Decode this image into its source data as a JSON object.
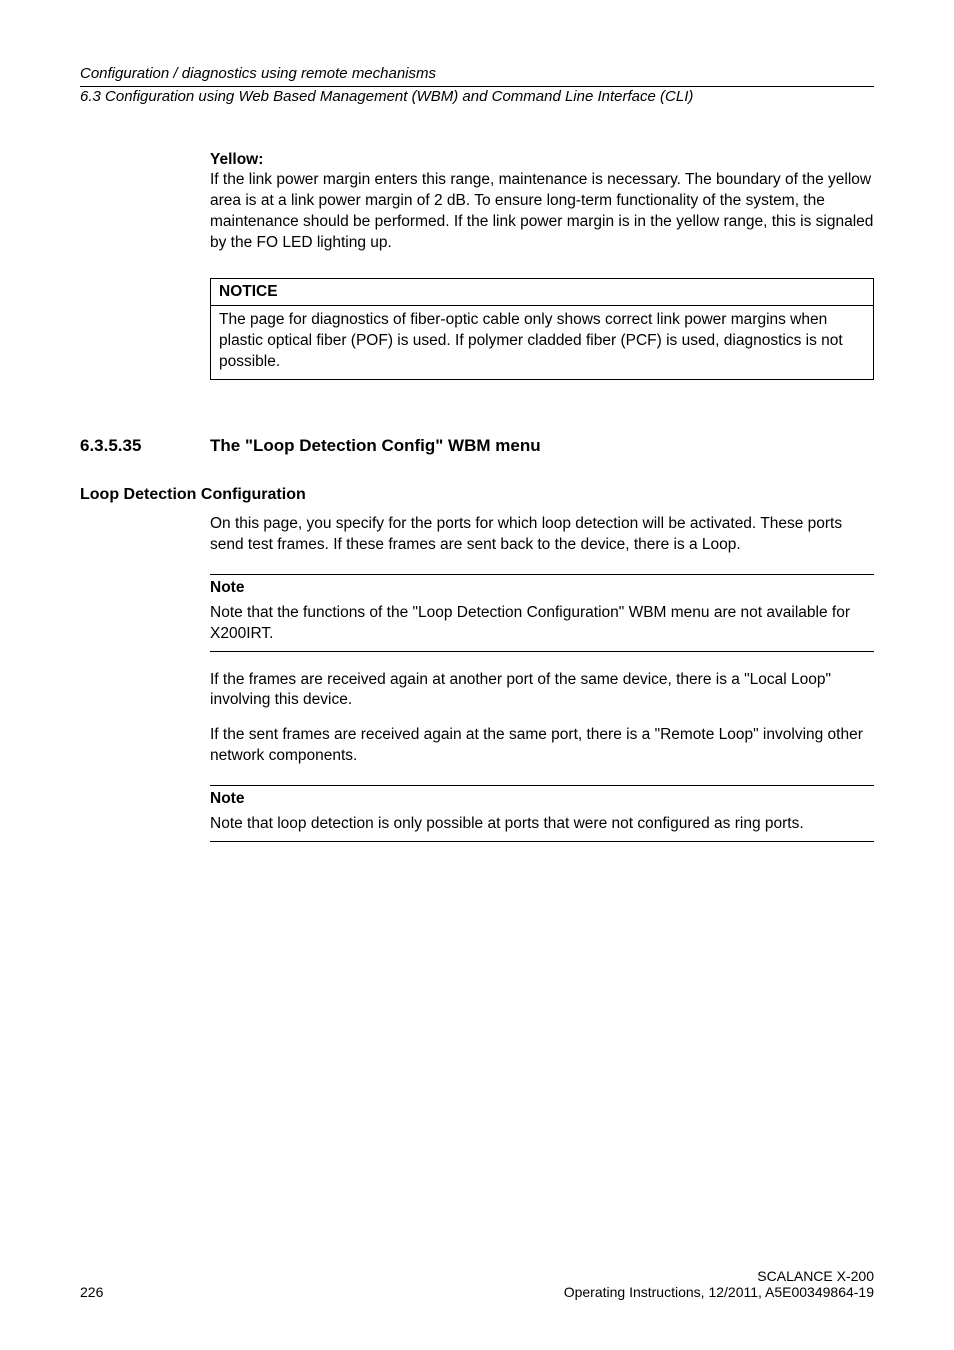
{
  "header": {
    "line1": "Configuration / diagnostics using remote mechanisms",
    "line2": "6.3 Configuration using Web Based Management (WBM) and Command Line Interface (CLI)"
  },
  "yellow": {
    "title": "Yellow:",
    "body": "If the link power margin enters this range, maintenance is necessary. The boundary of the yellow area is at a link power margin of 2 dB. To ensure long-term functionality of the system, the maintenance should be performed. If the link power margin is in the yellow range, this is signaled by the FO LED lighting up."
  },
  "notice": {
    "title": "NOTICE",
    "body": "The page for diagnostics of fiber-optic cable only shows correct link power margins when plastic optical fiber (POF) is used. If polymer cladded fiber (PCF) is used, diagnostics is not possible."
  },
  "section": {
    "num": "6.3.5.35",
    "title": "The \"Loop Detection Config\" WBM menu"
  },
  "loop": {
    "heading": "Loop Detection Configuration",
    "intro": "On this page, you specify for the ports for which loop detection will be activated. These ports send test frames. If these frames are sent back to the device, there is a Loop."
  },
  "note1": {
    "label": "Note",
    "body": "Note that the functions of the \"Loop Detection Configuration\" WBM menu are not available for X200IRT."
  },
  "para2": "If the frames are received again at another port of the same device, there is a \"Local Loop\" involving this device.",
  "para3": "If the sent frames are received again at the same port, there is a \"Remote Loop\" involving other network components.",
  "note2": {
    "label": "Note",
    "body": "Note that loop detection is only possible at ports that were not configured as ring ports."
  },
  "footer": {
    "page": "226",
    "right1": "SCALANCE X-200",
    "right2": "Operating Instructions, 12/2011, A5E00349864-19"
  }
}
